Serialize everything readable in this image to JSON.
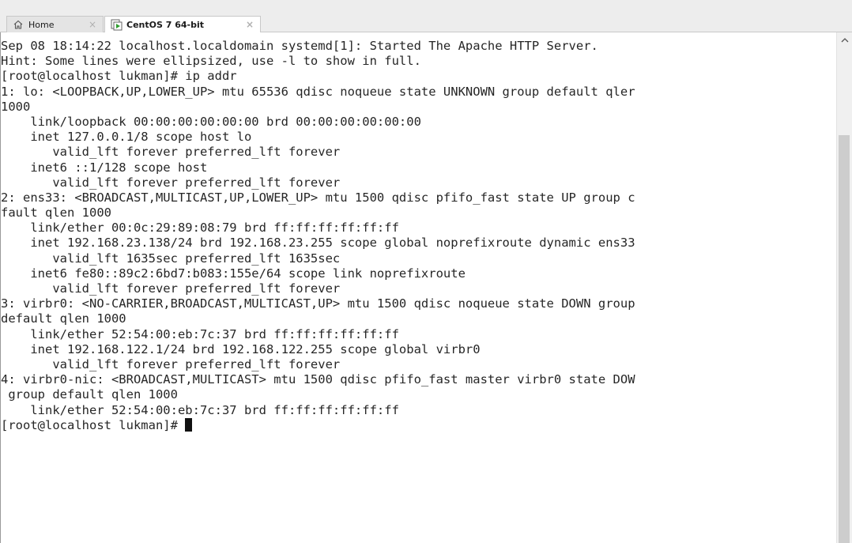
{
  "tabs": [
    {
      "label": "Home",
      "icon": "home-icon",
      "close": "×"
    },
    {
      "label": "CentOS 7 64-bit",
      "icon": "vm-power-icon",
      "close": "×"
    }
  ],
  "terminal": {
    "lines": [
      "Sep 08 18:14:22 localhost.localdomain systemd[1]: Started The Apache HTTP Server.",
      "Hint: Some lines were ellipsized, use -l to show in full.",
      "[root@localhost lukman]# ip addr",
      "1: lo: <LOOPBACK,UP,LOWER_UP> mtu 65536 qdisc noqueue state UNKNOWN group default qler",
      "1000",
      "    link/loopback 00:00:00:00:00:00 brd 00:00:00:00:00:00",
      "    inet 127.0.0.1/8 scope host lo",
      "       valid_lft forever preferred_lft forever",
      "    inet6 ::1/128 scope host",
      "       valid_lft forever preferred_lft forever",
      "2: ens33: <BROADCAST,MULTICAST,UP,LOWER_UP> mtu 1500 qdisc pfifo_fast state UP group c",
      "fault qlen 1000",
      "    link/ether 00:0c:29:89:08:79 brd ff:ff:ff:ff:ff:ff",
      "    inet 192.168.23.138/24 brd 192.168.23.255 scope global noprefixroute dynamic ens33",
      "       valid_lft 1635sec preferred_lft 1635sec",
      "    inet6 fe80::89c2:6bd7:b083:155e/64 scope link noprefixroute",
      "       valid_lft forever preferred_lft forever",
      "3: virbr0: <NO-CARRIER,BROADCAST,MULTICAST,UP> mtu 1500 qdisc noqueue state DOWN group",
      "default qlen 1000",
      "    link/ether 52:54:00:eb:7c:37 brd ff:ff:ff:ff:ff:ff",
      "    inet 192.168.122.1/24 brd 192.168.122.255 scope global virbr0",
      "       valid_lft forever preferred_lft forever",
      "4: virbr0-nic: <BROADCAST,MULTICAST> mtu 1500 qdisc pfifo_fast master virbr0 state DOW",
      " group default qlen 1000",
      "    link/ether 52:54:00:eb:7c:37 brd ff:ff:ff:ff:ff:ff"
    ],
    "prompt": "[root@localhost lukman]# "
  }
}
